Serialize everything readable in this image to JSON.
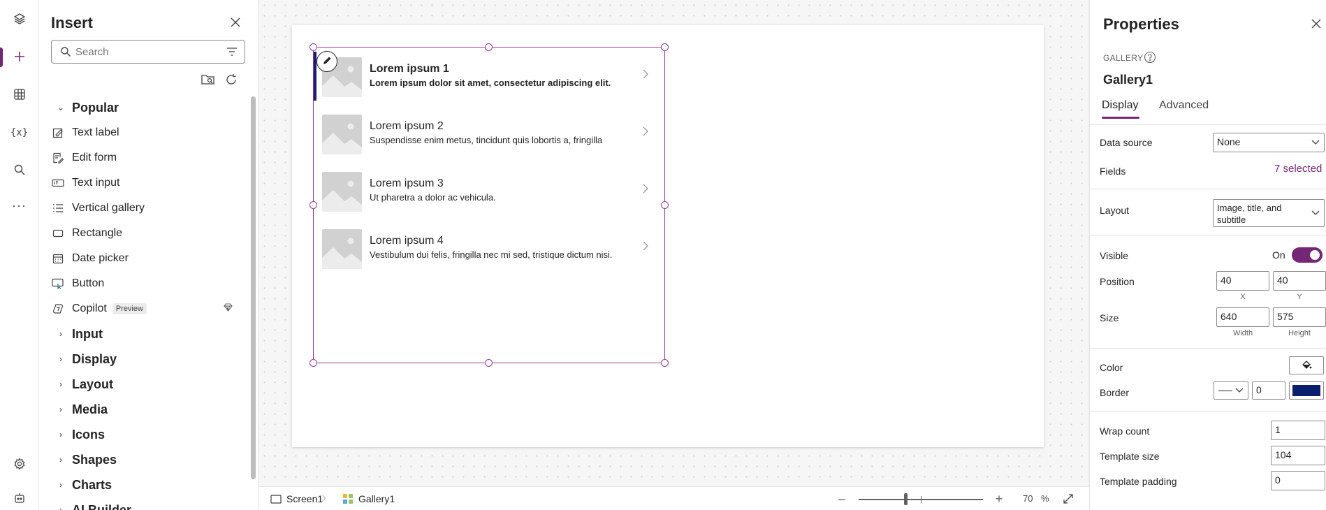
{
  "rail": {
    "items": [
      "tree-view",
      "insert",
      "data",
      "variables",
      "search",
      "more"
    ],
    "bottom": [
      "settings",
      "virtual-agent"
    ]
  },
  "insert_panel": {
    "title": "Insert",
    "search_placeholder": "Search",
    "popular_label": "Popular",
    "popular_items": [
      {
        "label": "Text label",
        "icon": "text-label-icon"
      },
      {
        "label": "Edit form",
        "icon": "edit-form-icon"
      },
      {
        "label": "Text input",
        "icon": "text-input-icon"
      },
      {
        "label": "Vertical gallery",
        "icon": "vertical-gallery-icon"
      },
      {
        "label": "Rectangle",
        "icon": "rectangle-icon"
      },
      {
        "label": "Date picker",
        "icon": "date-picker-icon"
      },
      {
        "label": "Button",
        "icon": "button-icon"
      },
      {
        "label": "Copilot",
        "icon": "copilot-icon",
        "badge": "Preview"
      }
    ],
    "groups": [
      "Input",
      "Display",
      "Layout",
      "Media",
      "Icons",
      "Shapes",
      "Charts",
      "AI Builder"
    ]
  },
  "gallery": {
    "rows": [
      {
        "title": "Lorem ipsum 1",
        "subtitle": "Lorem ipsum dolor sit amet, consectetur adipiscing elit."
      },
      {
        "title": "Lorem ipsum 2",
        "subtitle": "Suspendisse enim metus, tincidunt quis lobortis a, fringilla"
      },
      {
        "title": "Lorem ipsum 3",
        "subtitle": "Ut pharetra a dolor ac vehicula."
      },
      {
        "title": "Lorem ipsum 4",
        "subtitle": "Vestibulum dui felis, fringilla nec mi sed, tristique dictum nisi."
      }
    ],
    "selection_color": "#8f3c8f"
  },
  "statusbar": {
    "screen": "Screen1",
    "control": "Gallery1",
    "zoom_level": "70",
    "zoom_unit": "%"
  },
  "properties": {
    "title": "Properties",
    "control_type": "GALLERY",
    "control_name": "Gallery1",
    "tabs": [
      "Display",
      "Advanced"
    ],
    "active_tab": "Display",
    "data_source_label": "Data source",
    "data_source_value": "None",
    "fields_label": "Fields",
    "fields_value": "7 selected",
    "layout_label": "Layout",
    "layout_value_line1": "Image, title, and",
    "layout_value_line2": "subtitle",
    "visible_label": "Visible",
    "visible_state": "On",
    "position_label": "Position",
    "x_value": "40",
    "y_value": "40",
    "x_label": "X",
    "y_label": "Y",
    "size_label": "Size",
    "width_value": "640",
    "height_value": "575",
    "width_label": "Width",
    "height_label": "Height",
    "color_label": "Color",
    "border_label": "Border",
    "border_width": "0",
    "border_color": "#0b1e6e",
    "wrap_count_label": "Wrap count",
    "wrap_count_value": "1",
    "template_size_label": "Template size",
    "template_size_value": "104",
    "template_padding_label": "Template padding",
    "template_padding_value": "0",
    "accent_color": "#742774"
  }
}
